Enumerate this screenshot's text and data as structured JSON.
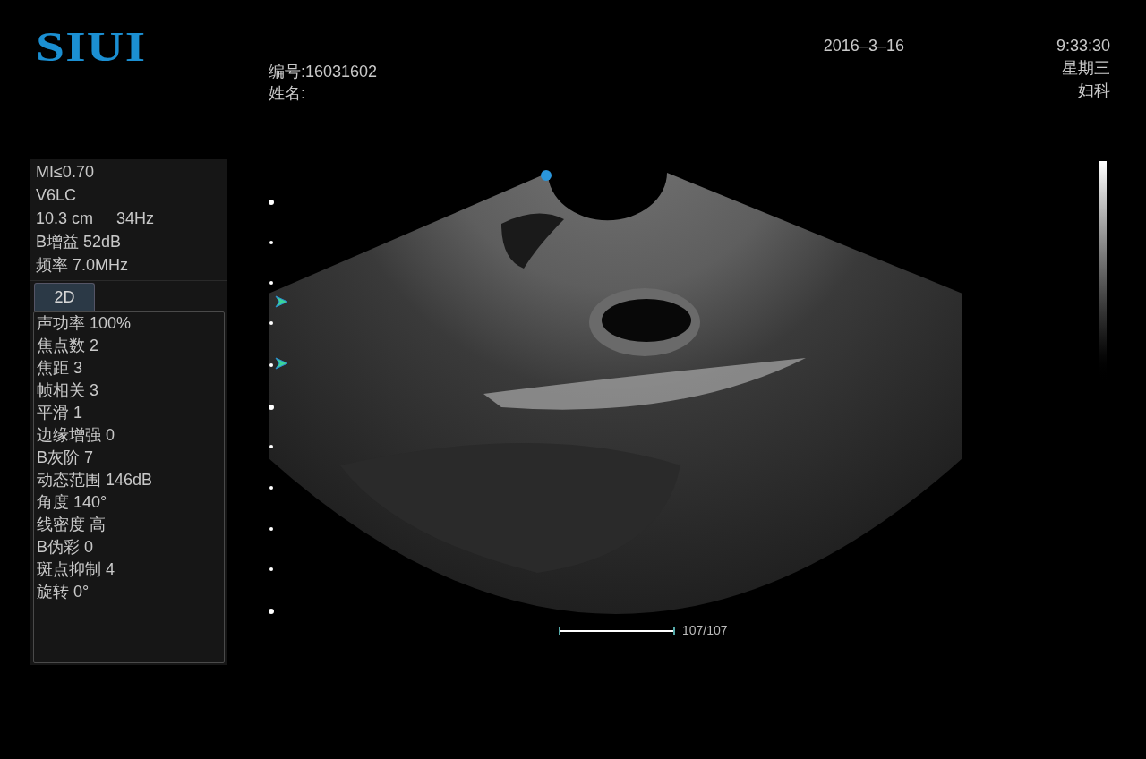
{
  "logo": {
    "text": "SIUI"
  },
  "patient": {
    "id": "编号:16031602",
    "name": "姓名:"
  },
  "clock": {
    "date": "2016–3–16",
    "time": "9:33:30",
    "weekday": "星期三",
    "department": "妇科"
  },
  "probe_info": {
    "mi": "MI≤0.70",
    "probe": "V6LC",
    "depth": "10.3 cm",
    "frame_rate": "34Hz",
    "gain": "B增益 52dB",
    "frequency": "频率 7.0MHz"
  },
  "tabs": [
    {
      "label": "2D",
      "selected": true
    }
  ],
  "parameters": [
    "声功率 100%",
    "焦点数 2",
    "焦距 3",
    "帧相关 3",
    "平滑 1",
    "边缘增强 0",
    "B灰阶 7",
    "动态范围 146dB",
    "角度 140°",
    "线密度 高",
    "B伪彩 0",
    "斑点抑制 4",
    "旋转 0°"
  ],
  "cine": {
    "level": 1,
    "reading": "107/107"
  }
}
